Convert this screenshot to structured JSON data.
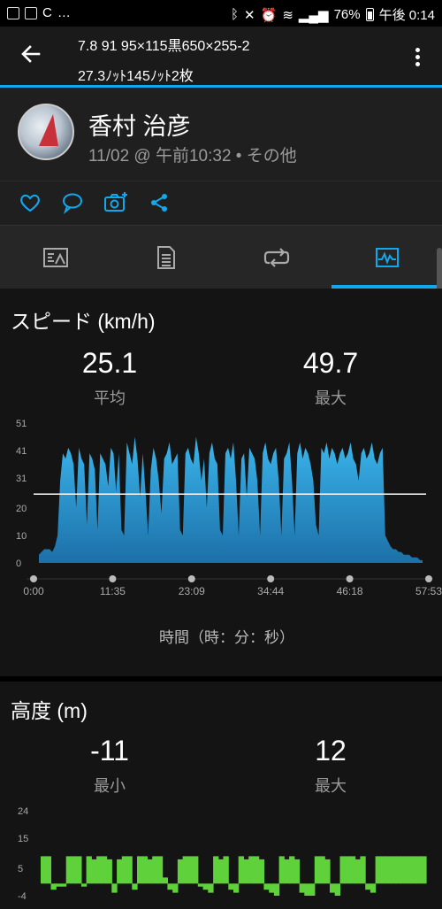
{
  "status_bar": {
    "battery": "76%",
    "time": "午後 0:14",
    "icons": [
      "gallery-icon",
      "sync-icon",
      "bluetooth-icon",
      "mute-icon",
      "alarm-icon",
      "wifi-icon",
      "signal-icon",
      "battery-icon"
    ]
  },
  "header": {
    "title_line1": "7.8 91 95×115黒650×255-2",
    "title_line2": "27.3ﾉｯﾄ145ﾉｯﾄ2枚"
  },
  "profile": {
    "name": "香村 治彦",
    "meta": "11/02 @ 午前10:32 • その他"
  },
  "actions": [
    "like-icon",
    "comment-icon",
    "add-photo-icon",
    "share-icon"
  ],
  "tabs": [
    {
      "icon": "overview-icon"
    },
    {
      "icon": "details-icon"
    },
    {
      "icon": "laps-icon"
    },
    {
      "icon": "charts-icon",
      "active": true
    }
  ],
  "speed": {
    "title": "スピード (km/h)",
    "avg_value": "25.1",
    "avg_label": "平均",
    "max_value": "49.7",
    "max_label": "最大",
    "x_axis_label": "時間（時：分：秒）",
    "chart_data": {
      "type": "area",
      "y_ticks": [
        "51",
        "41",
        "31",
        "20",
        "10",
        "0"
      ],
      "ylim": [
        0,
        51
      ],
      "x_ticks": [
        "0:00",
        "11:35",
        "23:09",
        "34:44",
        "46:18",
        "57:53"
      ],
      "average_line": 25.1,
      "color": "#2a9fd6",
      "values": [
        3,
        4,
        5,
        5,
        5,
        4,
        6,
        10,
        30,
        40,
        38,
        42,
        40,
        36,
        20,
        42,
        38,
        36,
        14,
        40,
        38,
        34,
        12,
        40,
        38,
        36,
        28,
        42,
        40,
        26,
        40,
        12,
        10,
        44,
        40,
        36,
        46,
        38,
        24,
        40,
        26,
        10,
        34,
        42,
        38,
        30,
        18,
        38,
        40,
        44,
        36,
        38,
        40,
        12,
        10,
        40,
        42,
        38,
        36,
        46,
        40,
        30,
        38,
        20,
        40,
        44,
        38,
        36,
        12,
        10,
        40,
        42,
        38,
        44,
        30,
        10,
        38,
        40,
        24,
        42,
        40,
        38,
        30,
        10,
        40,
        44,
        38,
        36,
        40,
        42,
        30,
        10,
        38,
        40,
        44,
        30,
        10,
        40,
        44,
        38,
        42,
        40,
        36,
        30,
        14,
        10,
        42,
        40,
        44,
        38,
        42,
        40,
        36,
        40,
        42,
        38,
        40,
        44,
        38,
        36,
        30,
        40,
        42,
        38,
        40,
        44,
        38,
        36,
        40,
        42,
        10,
        8,
        6,
        5,
        5,
        4,
        4,
        3,
        3,
        3,
        2,
        2,
        2,
        1,
        1
      ]
    }
  },
  "altitude": {
    "title": "高度 (m)",
    "min_value": "-11",
    "min_label": "最小",
    "max_value": "12",
    "max_label": "最大",
    "chart_data": {
      "type": "area",
      "y_ticks": [
        "24",
        "15",
        "5",
        "-4"
      ],
      "ylim": [
        -4,
        24
      ],
      "color": "#5fd13a",
      "values": [
        9,
        9,
        -2,
        -1,
        -1,
        9,
        9,
        9,
        -1,
        9,
        8,
        9,
        9,
        8,
        -3,
        8,
        9,
        9,
        -2,
        9,
        9,
        8,
        9,
        9,
        2,
        -2,
        -3,
        8,
        9,
        9,
        9,
        -1,
        -2,
        -3,
        9,
        8,
        9,
        -2,
        -3,
        9,
        8,
        9,
        9,
        8,
        -2,
        -3,
        -4,
        9,
        8,
        9,
        8,
        -3,
        -4,
        -4,
        9,
        9,
        8,
        -3,
        -4,
        9,
        9,
        9,
        8,
        9,
        -2,
        -3,
        9,
        9,
        9,
        9,
        9,
        9,
        9,
        9,
        9,
        9
      ]
    }
  }
}
